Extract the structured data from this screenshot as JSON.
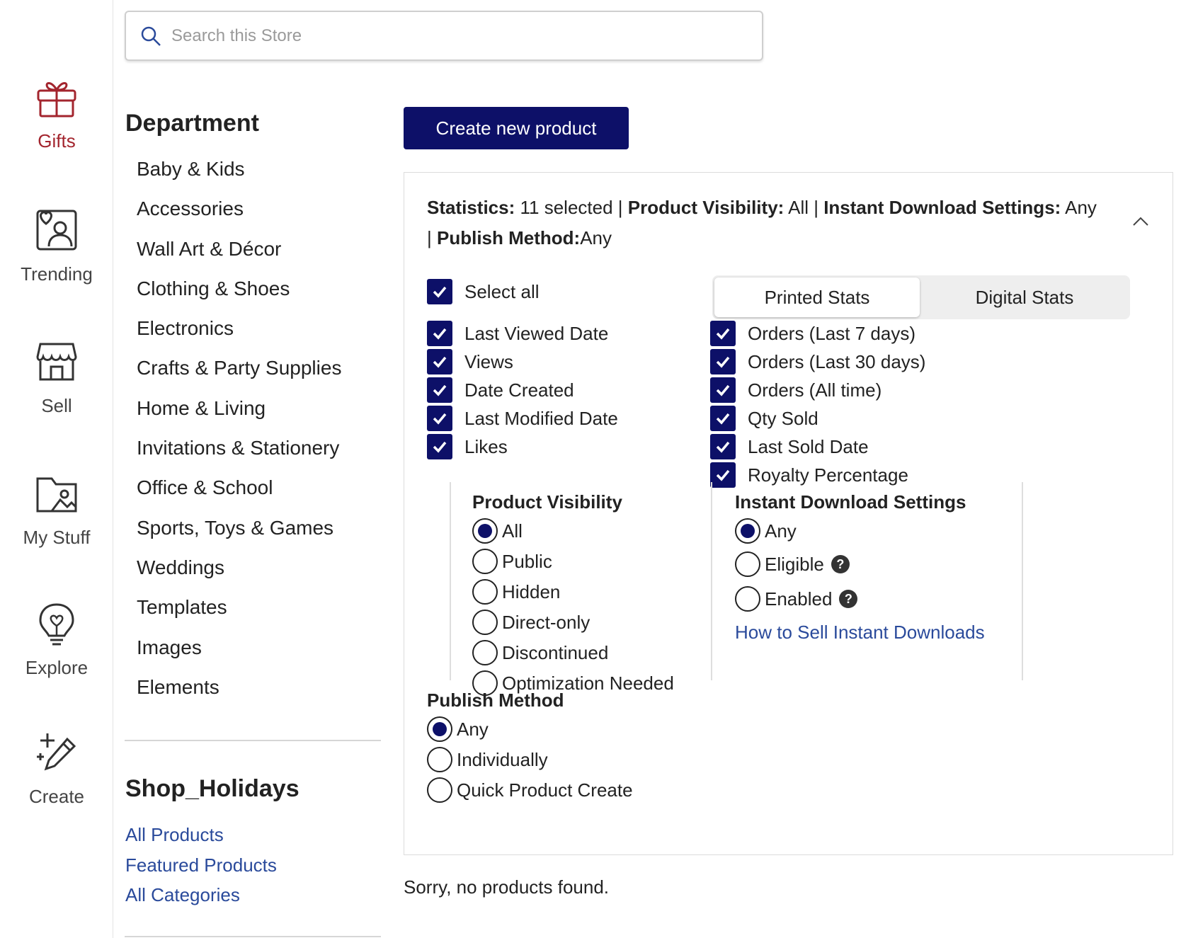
{
  "rail": {
    "items": [
      {
        "label": "Gifts",
        "icon": "gift-icon",
        "active": true
      },
      {
        "label": "Trending",
        "icon": "trending-icon"
      },
      {
        "label": "Sell",
        "icon": "store-icon"
      },
      {
        "label": "My Stuff",
        "icon": "folder-image-icon"
      },
      {
        "label": "Explore",
        "icon": "lightbulb-icon"
      },
      {
        "label": "Create",
        "icon": "magic-pencil-icon"
      }
    ]
  },
  "search": {
    "placeholder": "Search this Store"
  },
  "department": {
    "title": "Department",
    "items": [
      "Baby & Kids",
      "Accessories",
      "Wall Art & Décor",
      "Clothing & Shoes",
      "Electronics",
      "Crafts & Party Supplies",
      "Home & Living",
      "Invitations & Stationery",
      "Office & School",
      "Sports, Toys & Games",
      "Weddings",
      "Templates",
      "Images",
      "Elements"
    ]
  },
  "shop": {
    "title": "Shop_Holidays",
    "links": [
      "All Products",
      "Featured Products",
      "All Categories"
    ]
  },
  "main": {
    "create_label": "Create new product",
    "summary": {
      "stats_label": "Statistics:",
      "stats_value": " 11 selected | ",
      "visibility_label": "Product Visibility:",
      "visibility_value": " All | ",
      "download_label": "Instant Download Settings:",
      "download_value": " Any",
      "publish_prefix": "| ",
      "publish_label": "Publish Method:",
      "publish_value": "Any"
    },
    "select_all": "Select all",
    "left_checks": [
      "Last Viewed Date",
      "Views",
      "Date Created",
      "Last Modified Date",
      "Likes"
    ],
    "tabs": [
      "Printed Stats",
      "Digital Stats"
    ],
    "right_checks": [
      "Orders (Last 7 days)",
      "Orders (Last 30 days)",
      "Orders (All time)",
      "Qty Sold",
      "Last Sold Date",
      "Royalty Percentage"
    ],
    "visibility": {
      "title": "Product Visibility",
      "options": [
        "All",
        "Public",
        "Hidden",
        "Direct-only",
        "Discontinued",
        "Optimization Needed"
      ],
      "selected": "All"
    },
    "download": {
      "title": "Instant Download Settings",
      "options": [
        "Any",
        "Eligible",
        "Enabled"
      ],
      "selected": "Any",
      "help_glyph": "?",
      "link": "How to Sell Instant Downloads"
    },
    "publish": {
      "title": "Publish Method",
      "options": [
        "Any",
        "Individually",
        "Quick Product Create"
      ],
      "selected": "Any"
    },
    "empty_message": "Sorry, no products found."
  },
  "colors": {
    "accent": "#0d1068",
    "gifts": "#a3252e",
    "link": "#2a4a9b"
  }
}
